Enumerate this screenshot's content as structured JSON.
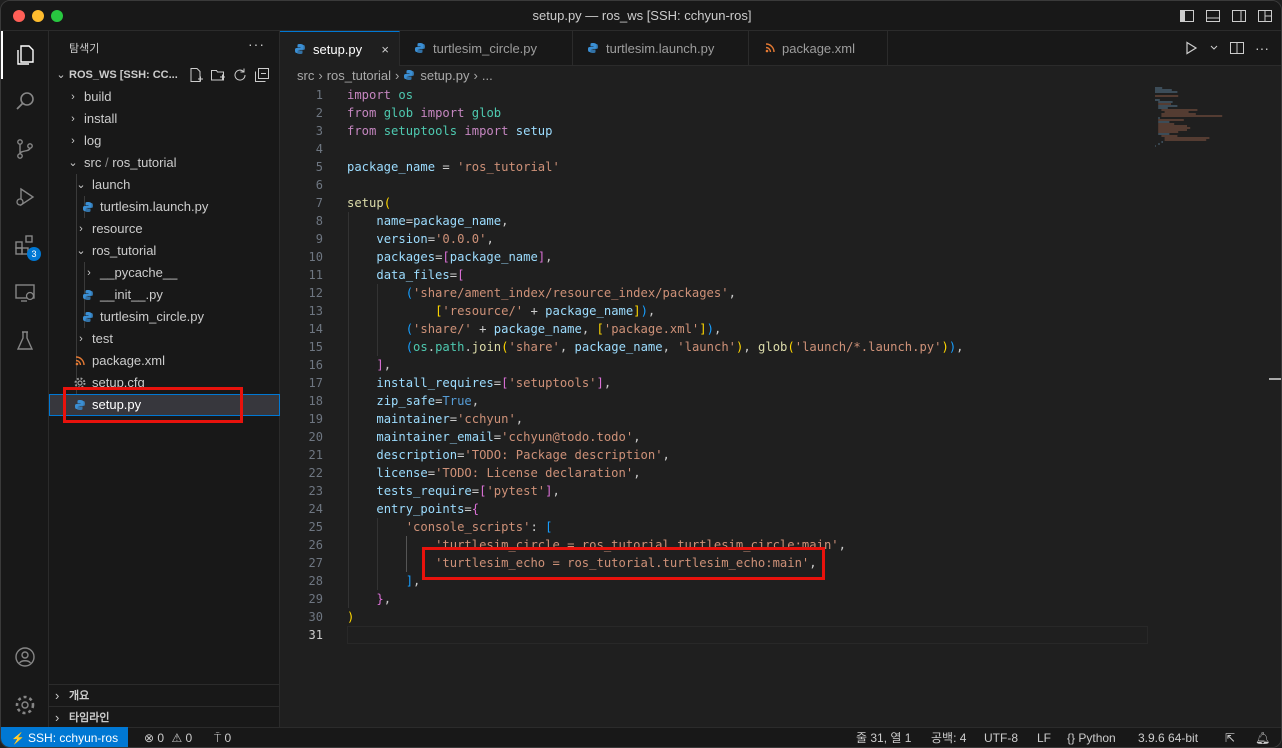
{
  "window": {
    "title": "setup.py — ros_ws [SSH: cchyun-ros]"
  },
  "activity_bar": {
    "extensions_badge": "3"
  },
  "sidebar": {
    "header": "탐색기",
    "more": "···",
    "root_label": "ROS_WS [SSH: CC...",
    "items": [
      {
        "label": "build"
      },
      {
        "label": "install"
      },
      {
        "label": "log"
      },
      {
        "label": "src",
        "suffix": "ros_tutorial"
      },
      {
        "label": "launch"
      },
      {
        "label": "turtlesim.launch.py"
      },
      {
        "label": "resource"
      },
      {
        "label": "ros_tutorial"
      },
      {
        "label": "__pycache__"
      },
      {
        "label": "__init__.py"
      },
      {
        "label": "turtlesim_circle.py"
      },
      {
        "label": "test"
      },
      {
        "label": "package.xml"
      },
      {
        "label": "setup.cfg"
      },
      {
        "label": "setup.py"
      }
    ],
    "outline": "개요",
    "timeline": "타임라인"
  },
  "tabs": [
    {
      "label": "setup.py",
      "close": "×"
    },
    {
      "label": "turtlesim_circle.py"
    },
    {
      "label": "turtlesim.launch.py"
    },
    {
      "label": "package.xml"
    }
  ],
  "breadcrumb": {
    "part1": "src",
    "part2": "ros_tutorial",
    "part3": "setup.py",
    "part4": "..."
  },
  "editor": {
    "line_numbers": [
      "1",
      "2",
      "3",
      "4",
      "5",
      "6",
      "7",
      "8",
      "9",
      "10",
      "11",
      "12",
      "13",
      "14",
      "15",
      "16",
      "17",
      "18",
      "19",
      "20",
      "21",
      "22",
      "23",
      "24",
      "25",
      "26",
      "27",
      "28",
      "29",
      "30",
      "31"
    ],
    "lines": [
      "import os",
      "from glob import glob",
      "from setuptools import setup",
      "",
      "package_name = 'ros_tutorial'",
      "",
      "setup(",
      "    name=package_name,",
      "    version='0.0.0',",
      "    packages=[package_name],",
      "    data_files=[",
      "        ('share/ament_index/resource_index/packages',",
      "            ['resource/' + package_name]),",
      "        ('share/' + package_name, ['package.xml']),",
      "        (os.path.join('share', package_name, 'launch'), glob('launch/*.launch.py')),",
      "    ],",
      "    install_requires=['setuptools'],",
      "    zip_safe=True,",
      "    maintainer='cchyun',",
      "    maintainer_email='cchyun@todo.todo',",
      "    description='TODO: Package description',",
      "    license='TODO: License declaration',",
      "    tests_require=['pytest'],",
      "    entry_points={",
      "        'console_scripts': [",
      "            'turtlesim_circle = ros_tutorial.turtlesim_circle:main',",
      "            'turtlesim_echo = ros_tutorial.turtlesim_echo:main',",
      "        ],",
      "    },",
      ")",
      ""
    ]
  },
  "statusbar": {
    "remote": "SSH: cchyun-ros",
    "errors": "0",
    "warnings": "0",
    "ports": "0",
    "position": "줄 31, 열 1",
    "spaces": "공백: 4",
    "encoding": "UTF-8",
    "eol": "LF",
    "language": "Python",
    "interpreter": "3.9.6 64-bit"
  },
  "icons": [
    "explorer-icon",
    "search-icon",
    "source-control-icon",
    "run-debug-icon",
    "extensions-icon",
    "remote-explorer-icon",
    "testing-icon",
    "account-icon",
    "manage-gear-icon",
    "python-file-icon",
    "rss-file-icon",
    "gear-file-icon"
  ],
  "colors": {
    "accent": "#0078d4",
    "highlight_box": "#e8120c",
    "keyword": "#c586c0",
    "string": "#ce9178",
    "variable": "#9cdcfe",
    "function": "#dcdcaa"
  }
}
